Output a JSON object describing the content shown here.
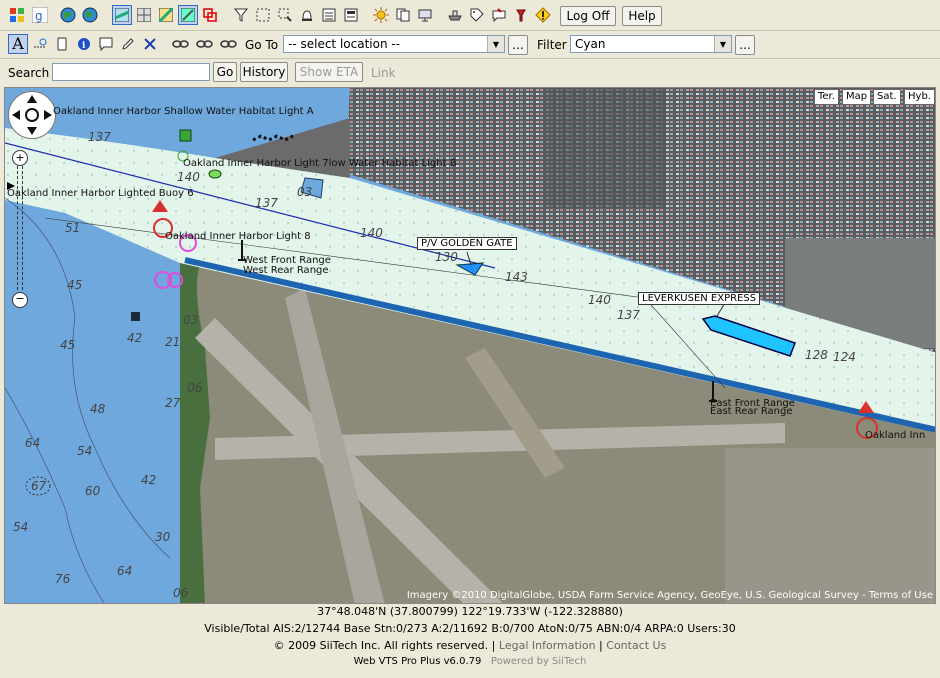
{
  "toolbar": {
    "log_off_label": "Log Off",
    "help_label": "Help",
    "goto_label": "Go To",
    "goto_value": "-- select location --",
    "goto_more": "...",
    "filter_label": "Filter",
    "filter_value": "Cyan",
    "filter_more": "...",
    "search_label": "Search",
    "search_value": "",
    "go_label": "Go",
    "history_label": "History",
    "show_eta_label": "Show ETA",
    "link_label": "Link"
  },
  "map": {
    "types": [
      "Ter.",
      "Map",
      "Sat.",
      "Hyb."
    ],
    "labels": {
      "habitat_a": "Oakland Inner Harbor Shallow Water Habitat Light A",
      "habitat_b": "Oakland Inner Harbor Light 7low Water Habitat Light B",
      "buoy6": "Oakland Inner Harbor Lighted Buoy 6",
      "light8": "Oakland Inner Harbor Light 8",
      "west_front": "West Front Range",
      "west_rear": "West Rear Range",
      "east_front": "East Front Range",
      "east_rear": "East Rear Range",
      "oakland_inner": "Oakland Inn"
    },
    "ships": {
      "golden_gate": "P/V GOLDEN GATE",
      "leverkusen": "LEVERKUSEN EXPRESS"
    },
    "depths": [
      "137",
      "140",
      "03",
      "137",
      "140",
      "130",
      "143",
      "140",
      "137",
      "128",
      "124",
      "51",
      "45",
      "45",
      "42",
      "21",
      "03",
      "06",
      "27",
      "48",
      "64",
      "54",
      "42",
      "60",
      "30",
      "54",
      "64",
      "76",
      "06",
      "67"
    ],
    "attribution": "Imagery ©2010 DigitalGlobe, USDA Farm Service Agency, GeoEye, U.S. Geological Survey - Terms of Use"
  },
  "status": {
    "coords": "37°48.048'N (37.800799)   122°19.733'W (-122.328880)",
    "counts": "Visible/Total AIS:2/12744  Base Stn:0/273  A:2/11692  B:0/700  AtoN:0/75  ABN:0/4  ARPA:0  Users:30",
    "copyright": "© 2009 SiiTech Inc. All rights reserved.",
    "legal": "Legal Information",
    "contact": "Contact Us",
    "sep": "|",
    "version": "Web VTS Pro Plus v6.0.79",
    "powered": "Powered by SiiTech"
  }
}
